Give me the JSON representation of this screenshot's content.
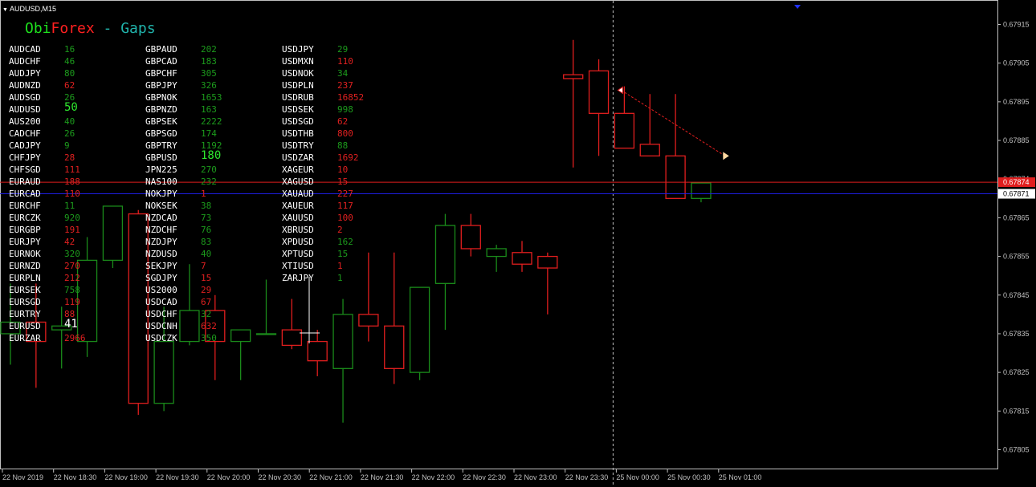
{
  "window": {
    "title": "AUDUSD,M15"
  },
  "panel": {
    "title_part1": "Obi",
    "title_part2": "Forex",
    "title_part3": " - Gaps",
    "color_part1": "#1ee01e",
    "color_part2": "#ff2020",
    "color_part3": "#20b2aa",
    "columns": [
      [
        {
          "symbol": "AUDCAD",
          "value": "16",
          "color": "green"
        },
        {
          "symbol": "AUDCHF",
          "value": "46",
          "color": "green"
        },
        {
          "symbol": "AUDJPY",
          "value": "80",
          "color": "green"
        },
        {
          "symbol": "AUDNZD",
          "value": "62",
          "color": "red"
        },
        {
          "symbol": "AUDSGD",
          "value": "26",
          "color": "green"
        },
        {
          "symbol": "AUDUSD",
          "value": "50",
          "color": "limegreen",
          "big": true
        },
        {
          "symbol": "AUS200",
          "value": "40",
          "color": "green"
        },
        {
          "symbol": "CADCHF",
          "value": "26",
          "color": "green"
        },
        {
          "symbol": "CADJPY",
          "value": "9",
          "color": "green"
        },
        {
          "symbol": "CHFJPY",
          "value": "28",
          "color": "red"
        },
        {
          "symbol": "CHFSGD",
          "value": "111",
          "color": "red"
        },
        {
          "symbol": "EURAUD",
          "value": "188",
          "color": "red"
        },
        {
          "symbol": "EURCAD",
          "value": "110",
          "color": "red"
        },
        {
          "symbol": "EURCHF",
          "value": "11",
          "color": "green"
        },
        {
          "symbol": "EURCZK",
          "value": "920",
          "color": "green"
        },
        {
          "symbol": "EURGBP",
          "value": "191",
          "color": "red"
        },
        {
          "symbol": "EURJPY",
          "value": "42",
          "color": "red"
        },
        {
          "symbol": "EURNOK",
          "value": "320",
          "color": "green"
        },
        {
          "symbol": "EURNZD",
          "value": "270",
          "color": "red"
        },
        {
          "symbol": "EURPLN",
          "value": "212",
          "color": "red"
        },
        {
          "symbol": "EURSEK",
          "value": "758",
          "color": "green"
        },
        {
          "symbol": "EURSGD",
          "value": "119",
          "color": "red"
        },
        {
          "symbol": "EURTRY",
          "value": "88",
          "color": "red"
        },
        {
          "symbol": "EURUSD",
          "value": "41",
          "color": "white",
          "big": true
        },
        {
          "symbol": "EURZAR",
          "value": "2966",
          "color": "red"
        }
      ],
      [
        {
          "symbol": "GBPAUD",
          "value": "202",
          "color": "green"
        },
        {
          "symbol": "GBPCAD",
          "value": "183",
          "color": "green"
        },
        {
          "symbol": "GBPCHF",
          "value": "305",
          "color": "green"
        },
        {
          "symbol": "GBPJPY",
          "value": "326",
          "color": "green"
        },
        {
          "symbol": "GBPNOK",
          "value": "1653",
          "color": "green"
        },
        {
          "symbol": "GBPNZD",
          "value": "163",
          "color": "green"
        },
        {
          "symbol": "GBPSEK",
          "value": "2222",
          "color": "green"
        },
        {
          "symbol": "GBPSGD",
          "value": "174",
          "color": "green"
        },
        {
          "symbol": "GBPTRY",
          "value": "1192",
          "color": "green"
        },
        {
          "symbol": "GBPUSD",
          "value": "180",
          "color": "limegreen",
          "big": true
        },
        {
          "symbol": "JPN225",
          "value": "270",
          "color": "green"
        },
        {
          "symbol": "NAS100",
          "value": "232",
          "color": "green"
        },
        {
          "symbol": "NOKJPY",
          "value": "1",
          "color": "red"
        },
        {
          "symbol": "NOKSEK",
          "value": "38",
          "color": "green"
        },
        {
          "symbol": "NZDCAD",
          "value": "73",
          "color": "green"
        },
        {
          "symbol": "NZDCHF",
          "value": "76",
          "color": "green"
        },
        {
          "symbol": "NZDJPY",
          "value": "83",
          "color": "green"
        },
        {
          "symbol": "NZDUSD",
          "value": "40",
          "color": "green"
        },
        {
          "symbol": "SEKJPY",
          "value": "7",
          "color": "red"
        },
        {
          "symbol": "SGDJPY",
          "value": "15",
          "color": "red"
        },
        {
          "symbol": "US2000",
          "value": "29",
          "color": "red"
        },
        {
          "symbol": "USDCAD",
          "value": "67",
          "color": "red"
        },
        {
          "symbol": "USDCHF",
          "value": "32",
          "color": "green"
        },
        {
          "symbol": "USDCNH",
          "value": "632",
          "color": "red"
        },
        {
          "symbol": "USDCZK",
          "value": "350",
          "color": "green"
        }
      ],
      [
        {
          "symbol": "USDJPY",
          "value": "29",
          "color": "green"
        },
        {
          "symbol": "USDMXN",
          "value": "110",
          "color": "red"
        },
        {
          "symbol": "USDNOK",
          "value": "34",
          "color": "green"
        },
        {
          "symbol": "USDPLN",
          "value": "237",
          "color": "red"
        },
        {
          "symbol": "USDRUB",
          "value": "16852",
          "color": "red"
        },
        {
          "symbol": "USDSEK",
          "value": "998",
          "color": "green"
        },
        {
          "symbol": "USDSGD",
          "value": "62",
          "color": "red"
        },
        {
          "symbol": "USDTHB",
          "value": "800",
          "color": "red"
        },
        {
          "symbol": "USDTRY",
          "value": "88",
          "color": "green"
        },
        {
          "symbol": "USDZAR",
          "value": "1692",
          "color": "red"
        },
        {
          "symbol": "XAGEUR",
          "value": "10",
          "color": "red"
        },
        {
          "symbol": "XAGUSD",
          "value": "15",
          "color": "red"
        },
        {
          "symbol": "XAUAUD",
          "value": "227",
          "color": "red"
        },
        {
          "symbol": "XAUEUR",
          "value": "117",
          "color": "red"
        },
        {
          "symbol": "XAUUSD",
          "value": "100",
          "color": "red"
        },
        {
          "symbol": "XBRUSD",
          "value": "2",
          "color": "red"
        },
        {
          "symbol": "XPDUSD",
          "value": "162",
          "color": "green"
        },
        {
          "symbol": "XPTUSD",
          "value": "15",
          "color": "green"
        },
        {
          "symbol": "XTIUSD",
          "value": "1",
          "color": "red"
        },
        {
          "symbol": "ZARJPY",
          "value": "1",
          "color": "green"
        }
      ]
    ]
  },
  "colors": {
    "background": "#000000",
    "bull": "#1a8a1a",
    "bear": "#e01e1e",
    "axis": "#c0c0c0",
    "bid_line": "#e01e1e",
    "ask_line": "#1e1ee0",
    "red": "#e02020",
    "green": "#1c9a1c",
    "limegreen": "#2ee82e",
    "white": "#ffffff"
  },
  "chart_data": {
    "type": "candlestick",
    "symbol": "AUDUSD",
    "timeframe": "M15",
    "ylim": [
      0.678,
      0.6792
    ],
    "y_ticks": [
      "0.67915",
      "0.67905",
      "0.67895",
      "0.67885",
      "0.67874",
      "0.67865",
      "0.67855",
      "0.67845",
      "0.67835",
      "0.67825",
      "0.67815",
      "0.67805"
    ],
    "y_tick_values": [
      0.67915,
      0.67905,
      0.67895,
      0.67885,
      0.67875,
      0.67865,
      0.67855,
      0.67845,
      0.67835,
      0.67825,
      0.67815,
      0.67805
    ],
    "x_ticks": [
      "22 Nov 2019",
      "22 Nov 18:30",
      "22 Nov 19:00",
      "22 Nov 19:30",
      "22 Nov 20:00",
      "22 Nov 20:30",
      "22 Nov 21:00",
      "22 Nov 21:30",
      "22 Nov 22:00",
      "22 Nov 22:30",
      "22 Nov 23:00",
      "22 Nov 23:30",
      "25 Nov 00:00",
      "25 Nov 00:30",
      "25 Nov 01:00"
    ],
    "x_tick_bar_index": [
      0,
      2,
      4,
      6,
      8,
      10,
      12,
      14,
      16,
      18,
      20,
      22,
      24,
      26,
      28
    ],
    "bid_price": "0.67874",
    "ask_price": "0.67871",
    "bid_value": 0.678742,
    "ask_value": 0.678712,
    "weekend_separator_bar_index": 24,
    "gap_arrow": {
      "from_bar": 24,
      "from_price": 0.67898,
      "to_bar": 28,
      "to_price": 0.67881
    },
    "candles": [
      {
        "o": 0.67835,
        "h": 0.67848,
        "l": 0.67827,
        "c": 0.67838
      },
      {
        "o": 0.67838,
        "h": 0.67848,
        "l": 0.67821,
        "c": 0.67833
      },
      {
        "o": 0.67836,
        "h": 0.67842,
        "l": 0.67826,
        "c": 0.67837
      },
      {
        "o": 0.67833,
        "h": 0.6786,
        "l": 0.67829,
        "c": 0.67854
      },
      {
        "o": 0.67854,
        "h": 0.67868,
        "l": 0.67852,
        "c": 0.67868
      },
      {
        "o": 0.67866,
        "h": 0.67867,
        "l": 0.67814,
        "c": 0.67817
      },
      {
        "o": 0.67817,
        "h": 0.67842,
        "l": 0.67815,
        "c": 0.67833
      },
      {
        "o": 0.67833,
        "h": 0.67853,
        "l": 0.67832,
        "c": 0.67841
      },
      {
        "o": 0.67841,
        "h": 0.67845,
        "l": 0.67823,
        "c": 0.67833
      },
      {
        "o": 0.67833,
        "h": 0.67836,
        "l": 0.67823,
        "c": 0.67836
      },
      {
        "o": 0.67835,
        "h": 0.67849,
        "l": 0.67835,
        "c": 0.67835
      },
      {
        "o": 0.67836,
        "h": 0.67844,
        "l": 0.67831,
        "c": 0.67832
      },
      {
        "o": 0.67833,
        "h": 0.67836,
        "l": 0.67824,
        "c": 0.67828
      },
      {
        "o": 0.67826,
        "h": 0.67844,
        "l": 0.67812,
        "c": 0.6784
      },
      {
        "o": 0.6784,
        "h": 0.67856,
        "l": 0.67833,
        "c": 0.67837
      },
      {
        "o": 0.67837,
        "h": 0.67856,
        "l": 0.67822,
        "c": 0.67826
      },
      {
        "o": 0.67825,
        "h": 0.67847,
        "l": 0.67823,
        "c": 0.67847
      },
      {
        "o": 0.67848,
        "h": 0.67866,
        "l": 0.67836,
        "c": 0.67863
      },
      {
        "o": 0.67863,
        "h": 0.67866,
        "l": 0.67855,
        "c": 0.67857
      },
      {
        "o": 0.67855,
        "h": 0.67858,
        "l": 0.67851,
        "c": 0.67857
      },
      {
        "o": 0.67856,
        "h": 0.67859,
        "l": 0.67851,
        "c": 0.67853
      },
      {
        "o": 0.67855,
        "h": 0.67856,
        "l": 0.6784,
        "c": 0.67852
      },
      {
        "o": 0.67902,
        "h": 0.67911,
        "l": 0.67878,
        "c": 0.67901
      },
      {
        "o": 0.67903,
        "h": 0.67906,
        "l": 0.67881,
        "c": 0.67892
      },
      {
        "o": 0.67892,
        "h": 0.67899,
        "l": 0.67883,
        "c": 0.67883
      },
      {
        "o": 0.67884,
        "h": 0.67897,
        "l": 0.67881,
        "c": 0.67881
      },
      {
        "o": 0.67881,
        "h": 0.67897,
        "l": 0.6787,
        "c": 0.6787
      },
      {
        "o": 0.6787,
        "h": 0.67873,
        "l": 0.67869,
        "c": 0.67874
      }
    ]
  }
}
